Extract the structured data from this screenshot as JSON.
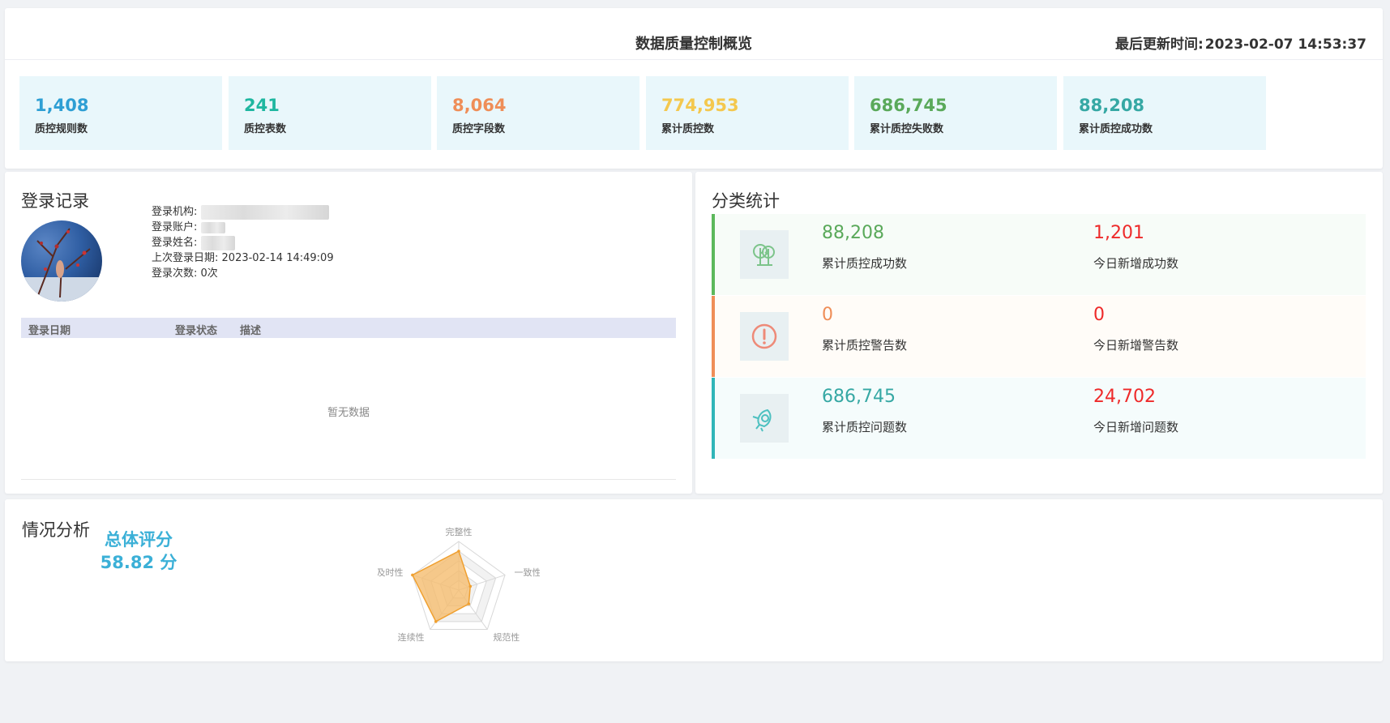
{
  "header": {
    "title": "数据质量控制概览",
    "updated_label": "最后更新时间:",
    "updated_value": "2023-02-07 14:53:37"
  },
  "stats": [
    {
      "value": "1,408",
      "label": "质控规则数",
      "color": "#2e9fd4"
    },
    {
      "value": "241",
      "label": "质控表数",
      "color": "#1fb7a0"
    },
    {
      "value": "8,064",
      "label": "质控字段数",
      "color": "#ef8e58"
    },
    {
      "value": "774,953",
      "label": "累计质控数",
      "color": "#f4c84e"
    },
    {
      "value": "686,745",
      "label": "累计质控失败数",
      "color": "#5aa95a"
    },
    {
      "value": "88,208",
      "label": "累计质控成功数",
      "color": "#36a8a4"
    }
  ],
  "login": {
    "title": "登录记录",
    "fields": [
      {
        "label": "登录机构:",
        "value": ""
      },
      {
        "label": "登录账户:",
        "value": ""
      },
      {
        "label": "登录姓名:",
        "value": ""
      },
      {
        "label": "上次登录日期:",
        "value": "2023-02-14 14:49:09"
      },
      {
        "label": "登录次数:",
        "value": "0次"
      }
    ],
    "table": {
      "columns": [
        "登录日期",
        "登录状态",
        "描述"
      ],
      "empty_text": "暂无数据"
    }
  },
  "classification": {
    "title": "分类统计",
    "rows": [
      {
        "icon": "tree-icon",
        "accent": "#5cb85c",
        "bg": "#f7fcf8",
        "value": "88,208",
        "value_color": "#5aa95a",
        "label": "累计质控成功数",
        "today_value": "1,201",
        "today_label": "今日新增成功数"
      },
      {
        "icon": "alert-icon",
        "accent": "#ef8e58",
        "bg": "#fffcf8",
        "value": "0",
        "value_color": "#ef8e58",
        "label": "累计质控警告数",
        "today_value": "0",
        "today_label": "今日新增警告数"
      },
      {
        "icon": "bug-icon",
        "accent": "#2fb5b8",
        "bg": "#f5fcfc",
        "value": "686,745",
        "value_color": "#36a8a4",
        "label": "累计质控问题数",
        "today_value": "24,702",
        "today_label": "今日新增问题数"
      }
    ]
  },
  "analysis": {
    "title": "情况分析",
    "score_label": "总体评分",
    "score_value": "58.82 分",
    "radar": {
      "axes": [
        "完整性",
        "一致性",
        "规范性",
        "连续性",
        "及时性"
      ],
      "values": [
        0.8,
        0.25,
        0.35,
        0.8,
        1.0
      ]
    }
  },
  "colors": {
    "radar_fill": "#f5bd6f",
    "radar_stroke": "#f0a030",
    "today_red": "#ee2a2a"
  }
}
